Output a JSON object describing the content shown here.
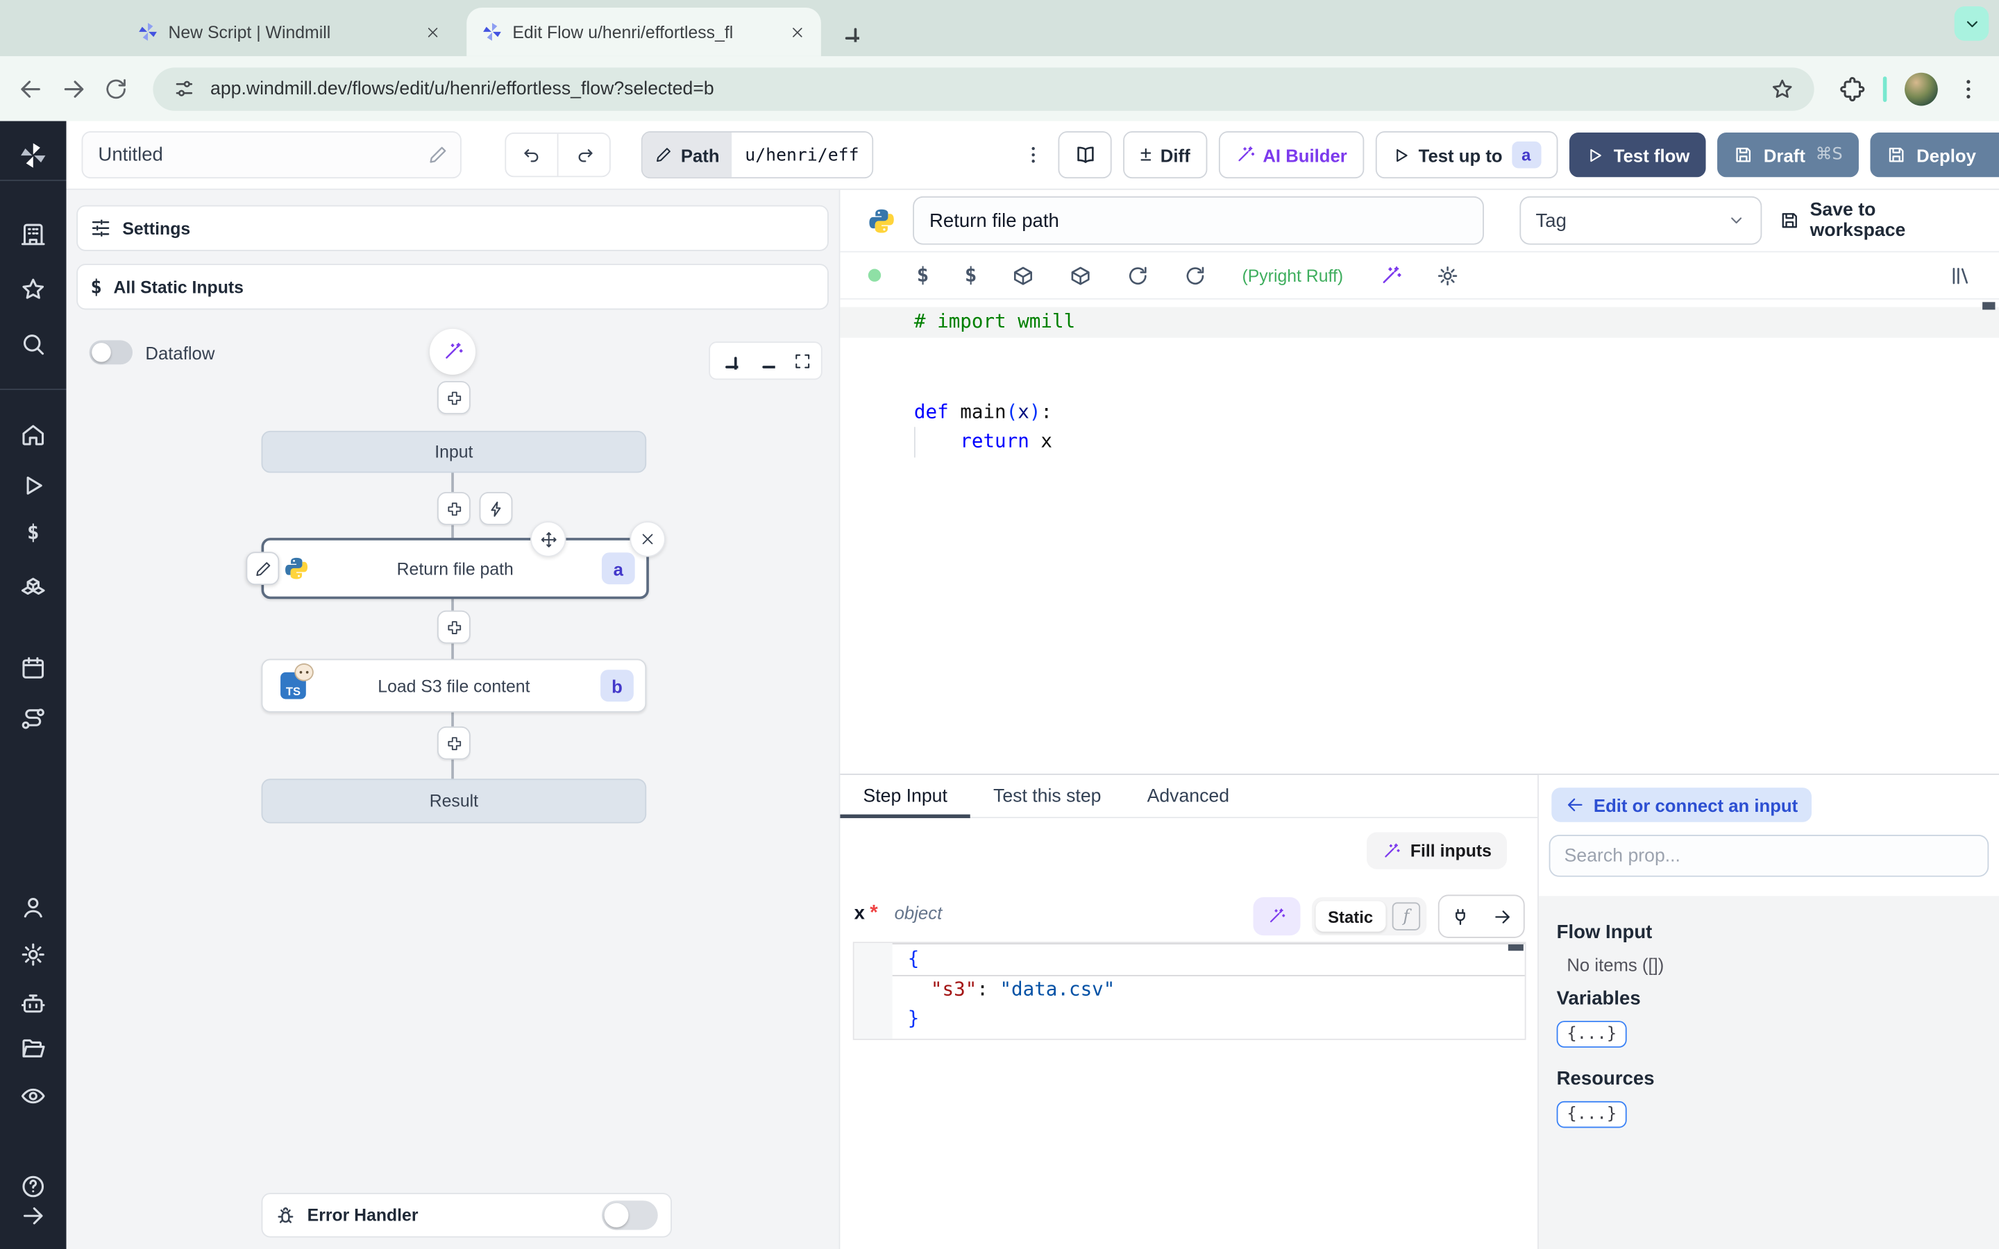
{
  "browser": {
    "tab1": "New Script | Windmill",
    "tab2": "Edit Flow u/henri/effortless_fl",
    "url": "app.windmill.dev/flows/edit/u/henri/effortless_flow?selected=b"
  },
  "toolbar": {
    "flow_name": "Untitled",
    "path_label": "Path",
    "path_value": "u/henri/eff",
    "diff_icon": "±",
    "diff": "Diff",
    "ai_builder": "AI Builder",
    "test_up_to": "Test up to",
    "test_up_to_badge": "a",
    "test_flow": "Test flow",
    "draft": "Draft",
    "draft_shortcut": "⌘S",
    "deploy": "Deploy"
  },
  "left_panel": {
    "settings": "Settings",
    "all_static_inputs": "All Static Inputs",
    "dataflow": "Dataflow"
  },
  "graph": {
    "input": "Input",
    "step_a_label": "Return file path",
    "step_a_badge": "a",
    "step_b_label": "Load S3 file content",
    "step_b_badge": "b",
    "step_b_icon_text": "TS",
    "result": "Result",
    "error_handler": "Error Handler"
  },
  "editor": {
    "step_name": "Return file path",
    "tag_placeholder": "Tag",
    "save_to_workspace": "Save to workspace",
    "lint": "(Pyright Ruff)",
    "code": {
      "l1": "# import wmill",
      "l4_kw": "def",
      "l4_name": " main",
      "l4_p1": "(",
      "l4_arg": "x",
      "l4_p2": ")",
      "l4_colon": ":",
      "l5_kw": "    return",
      "l5_val": " x"
    }
  },
  "step_panel": {
    "tabs": [
      "Step Input",
      "Test this step",
      "Advanced"
    ],
    "fill_inputs": "Fill inputs",
    "arg_name": "x",
    "required_marker": "*",
    "arg_type": "object",
    "static_label": "Static",
    "expr_icon_letter": "f",
    "json": {
      "open": "{",
      "indent": "  ",
      "key": "\"s3\"",
      "colon": ": ",
      "value": "\"data.csv\"",
      "close": "}"
    }
  },
  "connect_panel": {
    "back": "Edit or connect an input",
    "search_placeholder": "Search prop...",
    "flow_input_title": "Flow Input",
    "flow_input_empty": "No items ([])",
    "variables_title": "Variables",
    "variables_button": "{...}",
    "resources_title": "Resources",
    "resources_button": "{...}"
  },
  "sidebar_icons": [
    "windmill-logo",
    "workspace",
    "favorites",
    "search",
    "home",
    "runs",
    "variables",
    "resources",
    "schedules",
    "routes",
    "user",
    "settings",
    "workers",
    "folders",
    "audit-logs",
    "help",
    "expand"
  ],
  "colors": {
    "tabstrip_bg": "#d5e2dd",
    "chrome_bg": "#f1f7f4",
    "url_pill": "#dde9e4",
    "mint_chip": "#a9f2df",
    "sidebar_bg": "#1e2430",
    "accent_purple": "#7c3aed",
    "navy_btn": "#3e4e72",
    "slate_btn": "#64809f",
    "badge_bg": "#dbe3fa",
    "badge_text": "#4338ca",
    "lint_green": "#3fae5e",
    "link_blue": "#2c4fd2",
    "link_blue_bg": "#d9e5fb",
    "code_comment": "#008000",
    "code_keyword": "#0000ff",
    "code_brace": "#0431fa",
    "code_key": "#a31515",
    "code_string": "#0451a5"
  }
}
